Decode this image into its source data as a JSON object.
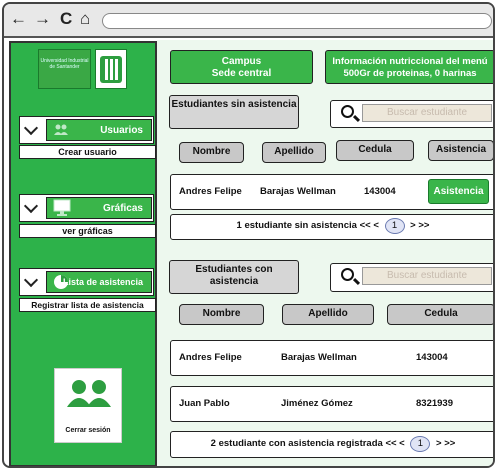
{
  "browser": {
    "back": "←",
    "forward": "→",
    "reload": "C",
    "home": "⌂"
  },
  "sidebar": {
    "logo_text": "Universidad Industrial de Santander",
    "menus": [
      {
        "label": "Usuarios",
        "link": "Crear usuario"
      },
      {
        "label": "Gráficas",
        "link": "ver gráficas"
      },
      {
        "label": "Lista de asistencia",
        "link": "Registrar lista de asistencia"
      }
    ],
    "logout": "Cerrar sesión"
  },
  "header": {
    "campus_title": "Campus",
    "campus_value": "Sede central",
    "menu_title": "Información nutriccional del menú",
    "menu_value": "500Gr de proteinas, 0 harinas"
  },
  "absent": {
    "title": "Estudiantes sin asistencia",
    "search_placeholder": "Buscar estudiante",
    "columns": [
      "Nombre",
      "Apellido",
      "Cedula",
      "Asistencia"
    ],
    "rows": [
      {
        "nombre": "Andres Felipe",
        "apellido": "Barajas Wellman",
        "cedula": "143004",
        "action": "Asistencia"
      }
    ],
    "pager_text": "1 estudiante sin asistencia",
    "pager_prev": "<< <",
    "pager_page": "1",
    "pager_next": "> >>"
  },
  "present": {
    "title": "Estudiantes con asistencia",
    "search_placeholder": "Buscar estudiante",
    "columns": [
      "Nombre",
      "Apellido",
      "Cedula"
    ],
    "rows": [
      {
        "nombre": "Andres Felipe",
        "apellido": "Barajas Wellman",
        "cedula": "143004"
      },
      {
        "nombre": "Juan Pablo",
        "apellido": "Jiménez Gómez",
        "cedula": "8321939"
      }
    ],
    "pager_text": "2 estudiante con asistencia registrada",
    "pager_prev": "<< <",
    "pager_page": "1",
    "pager_next": "> >>"
  },
  "colors": {
    "accent": "#3ab54a",
    "sidebar": "#2db24a",
    "background": "#edf8ee"
  }
}
